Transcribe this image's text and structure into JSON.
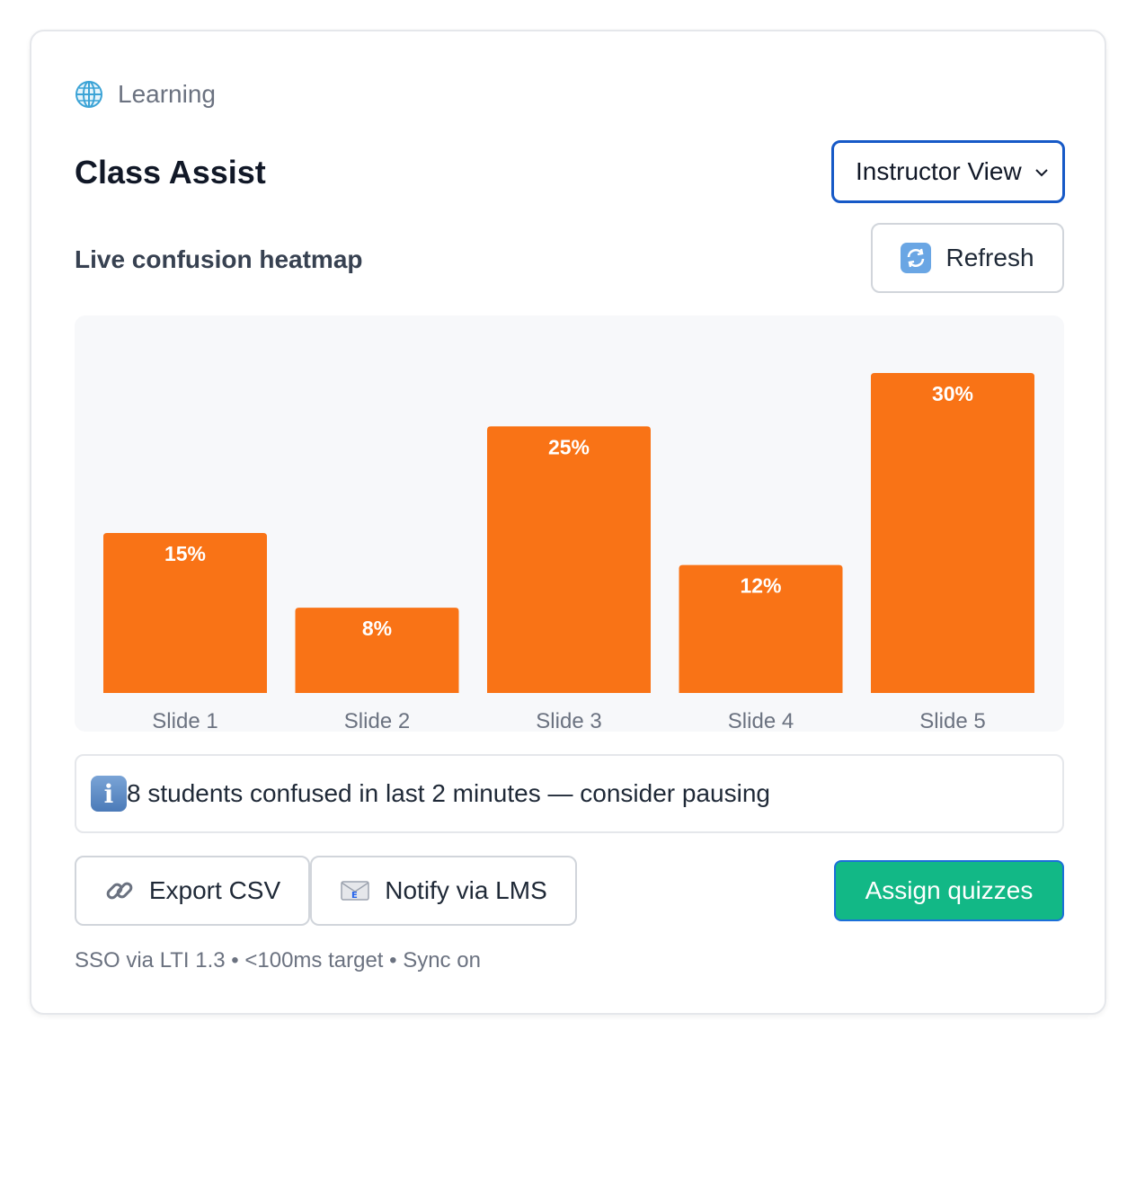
{
  "header": {
    "category_label": "Learning",
    "app_title": "Class Assist",
    "view_select": {
      "selected": "Instructor View"
    }
  },
  "section": {
    "title": "Live confusion heatmap",
    "refresh_label": "Refresh"
  },
  "chart_data": {
    "type": "bar",
    "categories": [
      "Slide 1",
      "Slide 2",
      "Slide 3",
      "Slide 4",
      "Slide 5"
    ],
    "values": [
      15,
      8,
      25,
      12,
      30
    ],
    "value_labels": [
      "15%",
      "8%",
      "25%",
      "12%",
      "30%"
    ],
    "unit": "%",
    "ylim": [
      0,
      30
    ],
    "grid": false,
    "bar_color": "#f97316",
    "title": "",
    "xlabel": "",
    "ylabel": ""
  },
  "alert": {
    "text": "8 students confused in last 2 minutes — consider pausing"
  },
  "actions": {
    "export_label": "Export CSV",
    "notify_label": "Notify via LMS",
    "assign_label": "Assign quizzes"
  },
  "footer": {
    "note": "SSO via LTI 1.3 • <100ms target • Sync on"
  },
  "colors": {
    "accent_orange": "#f97316",
    "primary_green": "#12b886",
    "focus_blue": "#1659c7"
  },
  "icons": {
    "category": "globe-icon",
    "refresh": "refresh-icon",
    "alert": "info-icon",
    "export": "link-icon",
    "notify": "envelope-icon",
    "select": "chevron-down-icon"
  }
}
